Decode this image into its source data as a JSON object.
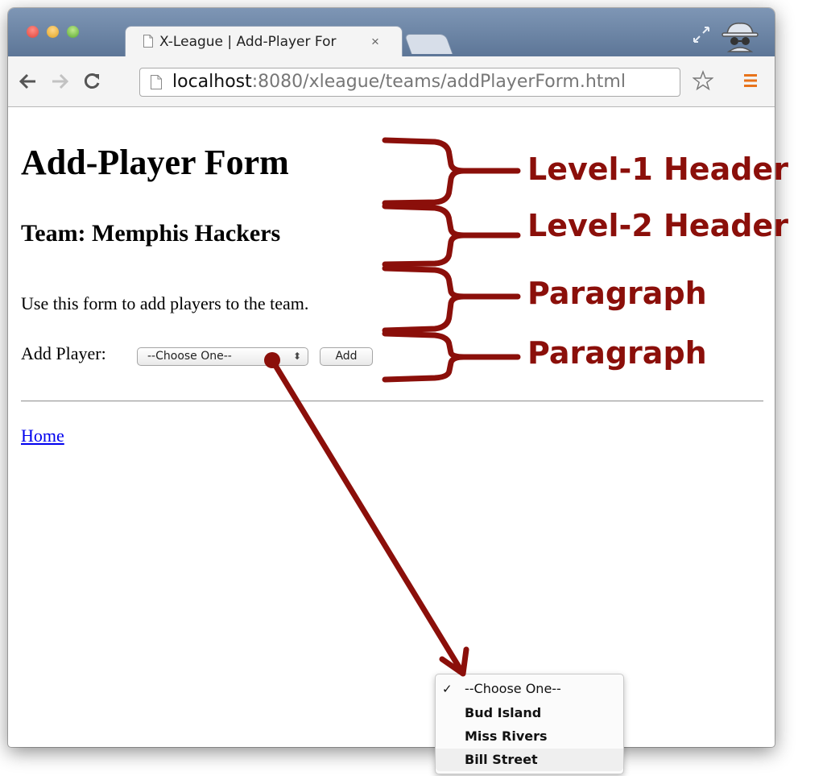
{
  "browser": {
    "tab_title": "X-League | Add-Player For",
    "tab_close": "×",
    "url_host": "localhost",
    "url_path": ":8080/xleague/teams/addPlayerForm.html",
    "icons": [
      "document-icon",
      "fullscreen-icon",
      "incognito-icon",
      "back-arrow-icon",
      "forward-arrow-icon",
      "reload-icon",
      "page-icon",
      "star-icon",
      "menu-icon"
    ]
  },
  "page": {
    "h1": "Add-Player Form",
    "h2": "Team: Memphis Hackers",
    "paragraph": "Use this form to add players to the team.",
    "add_player_label": "Add Player:",
    "select_value": "--Choose One--",
    "add_button": "Add",
    "home_link": "Home"
  },
  "dropdown": {
    "options": [
      {
        "label": "--Choose One--",
        "checked": true
      },
      {
        "label": "Bud Island",
        "checked": false
      },
      {
        "label": "Miss Rivers",
        "checked": false
      },
      {
        "label": "Bill Street",
        "checked": false
      }
    ],
    "check_glyph": "✓"
  },
  "annotations": {
    "level1": "Level-1 Header",
    "level2": "Level-2 Header",
    "paragraph1": "Paragraph",
    "paragraph2": "Paragraph",
    "color": "#8b0f0a"
  },
  "colors": {
    "titlebar": "#6d86a6",
    "link": "#0000ee",
    "menu_orange": "#e8731b"
  }
}
